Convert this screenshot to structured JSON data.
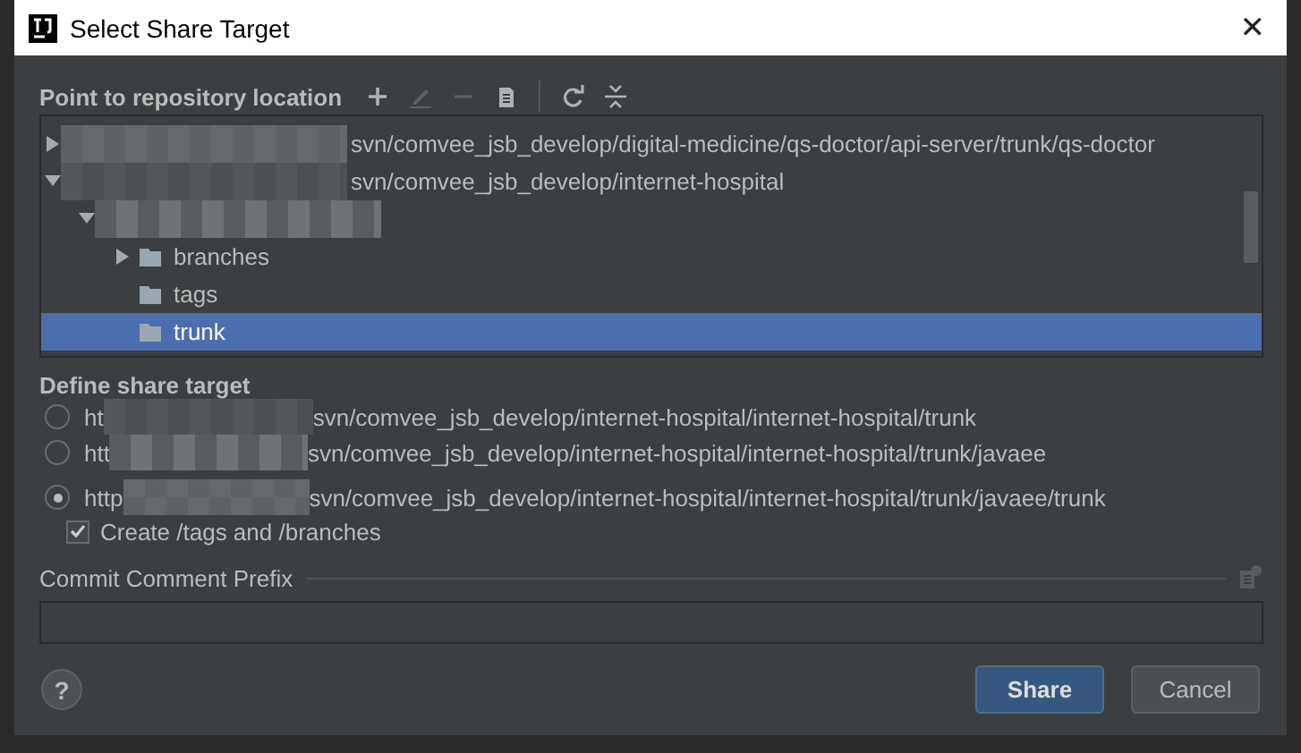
{
  "window": {
    "title": "Select Share Target",
    "close": "✕"
  },
  "repository": {
    "label": "Point to repository location",
    "toolbar": [
      {
        "kind": "add",
        "disabled": false
      },
      {
        "kind": "edit",
        "disabled": true
      },
      {
        "kind": "remove",
        "disabled": true
      },
      {
        "kind": "clipboard",
        "disabled": false
      },
      {
        "kind": "refresh",
        "disabled": false
      },
      {
        "kind": "collapse",
        "disabled": false
      }
    ],
    "tree": [
      {
        "label": "svn/comvee_jsb_develop/digital-medicine/qs-doctor/api-server/trunk/qs-doctor",
        "redacted": true,
        "expandable": true,
        "expanded": false,
        "selected": false
      },
      {
        "label": "svn/comvee_jsb_develop/internet-hospital",
        "redacted": true,
        "expandable": true,
        "expanded": true,
        "selected": false,
        "children": [
          {
            "redacted": true,
            "expandable": true,
            "expanded": true,
            "selected": false,
            "children": [
              {
                "label": "branches",
                "redacted": false,
                "expandable": true,
                "expanded": false,
                "selected": false
              },
              {
                "label": "tags",
                "redacted": false,
                "expandable": false,
                "selected": false
              },
              {
                "label": "trunk",
                "redacted": false,
                "expandable": false,
                "selected": true
              }
            ]
          }
        ]
      }
    ]
  },
  "share_target": {
    "label": "Define share target",
    "options": [
      {
        "prefix": "ht",
        "path": "svn/comvee_jsb_develop/internet-hospital/internet-hospital/trunk",
        "redacted": true,
        "selected": false
      },
      {
        "prefix": "htt",
        "path": "svn/comvee_jsb_develop/internet-hospital/internet-hospital/trunk/javaee",
        "redacted": true,
        "selected": false
      },
      {
        "prefix": "http",
        "path": "svn/comvee_jsb_develop/internet-hospital/internet-hospital/trunk/javaee/trunk",
        "redacted": true,
        "selected": true
      }
    ],
    "create_dirs": {
      "label": "Create /tags and /branches",
      "checked": true
    }
  },
  "commit": {
    "label": "Commit Comment Prefix"
  },
  "footer": {
    "help": "?",
    "buttons": [
      {
        "label": "Share",
        "default": true
      },
      {
        "label": "Cancel",
        "default": false
      }
    ]
  }
}
